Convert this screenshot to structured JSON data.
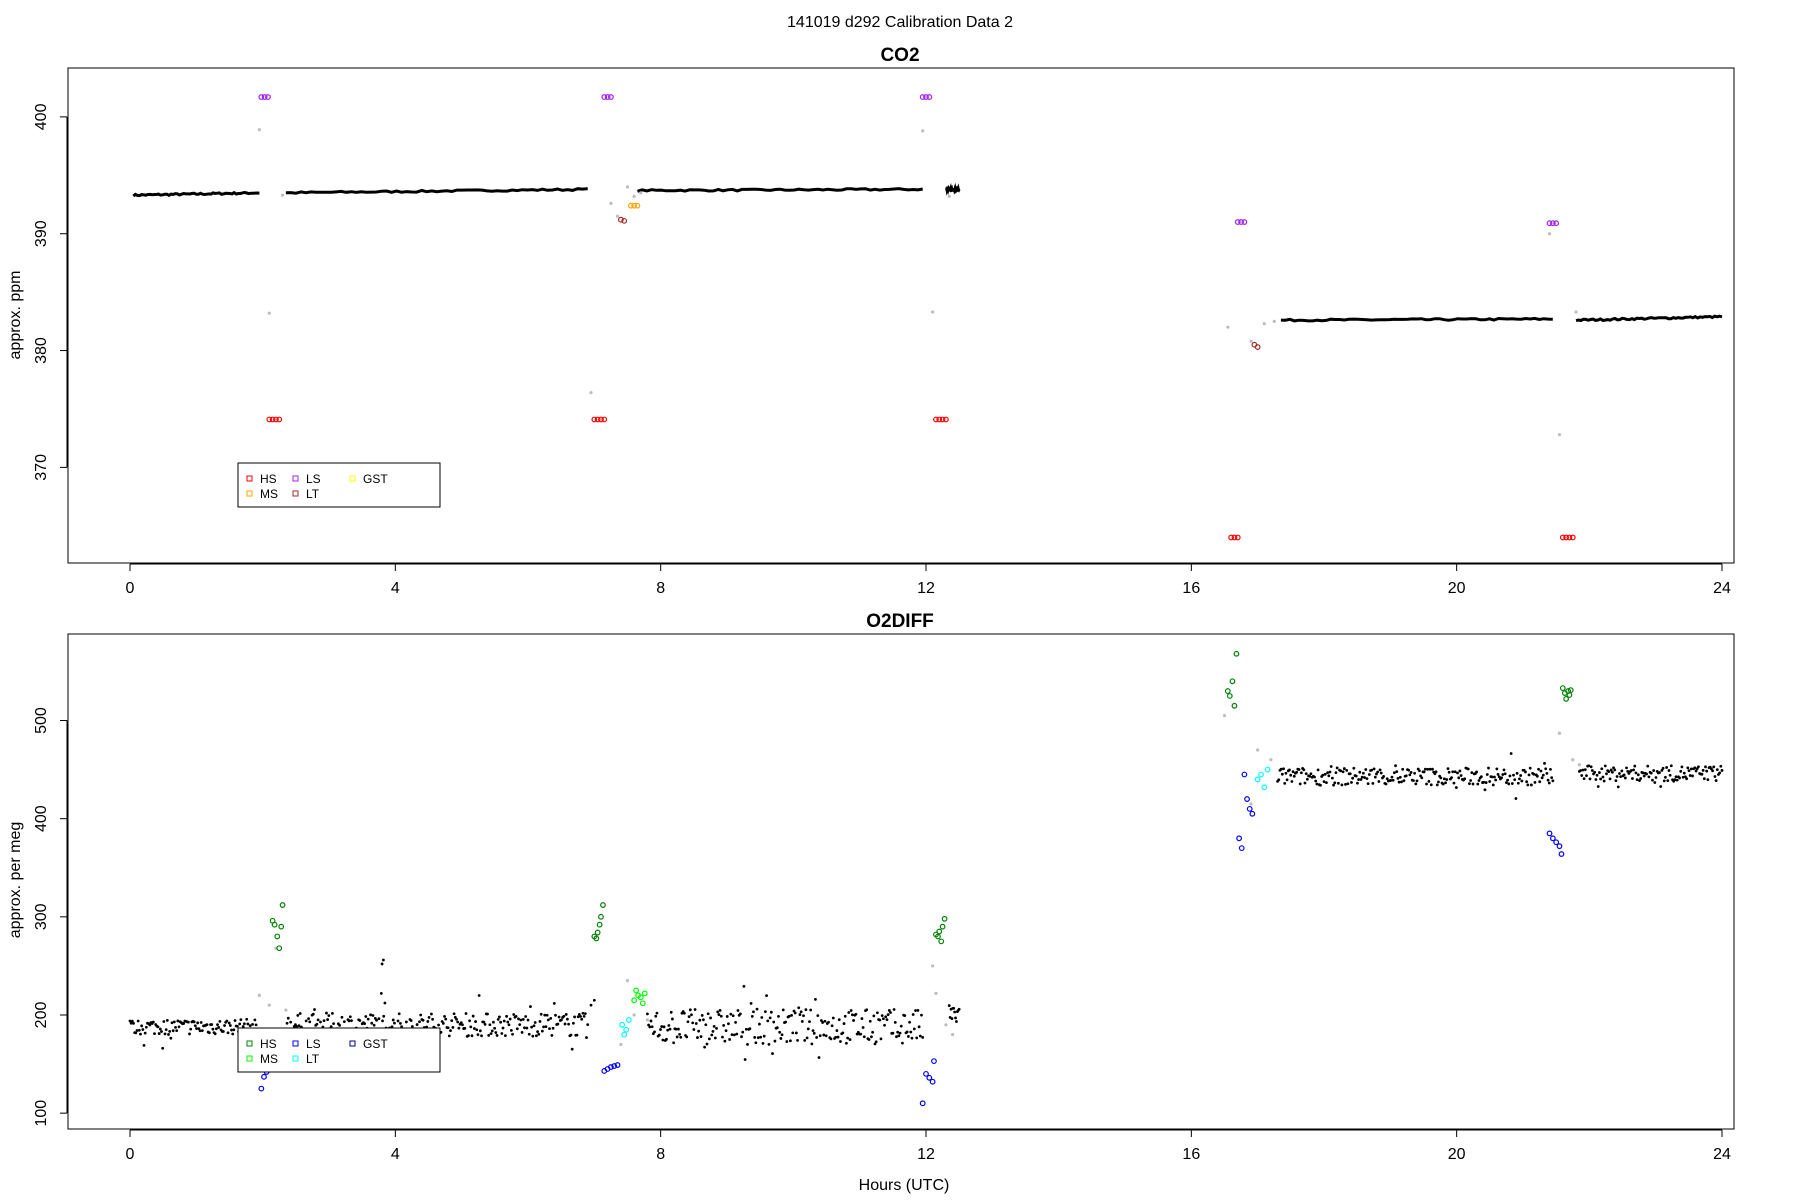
{
  "figure": {
    "title": "141019   d292   Calibration Data 2",
    "xlabel": "Hours (UTC)"
  },
  "chart_data": [
    {
      "type": "scatter",
      "title": "CO2",
      "xlabel": "",
      "ylabel": "approx. ppm",
      "xlim": [
        0,
        24
      ],
      "ylim": [
        362.5,
        403.5
      ],
      "xticks": [
        "0",
        "4",
        "8",
        "12",
        "16",
        "20",
        "24"
      ],
      "yticks": [
        "370",
        "380",
        "390",
        "400"
      ],
      "legend": {
        "position": "bottom-left",
        "entries": [
          {
            "label": "HS",
            "color": "#ff0000"
          },
          {
            "label": "LS",
            "color": "#a020f0"
          },
          {
            "label": "GST",
            "color": "#ffff00"
          },
          {
            "label": "MS",
            "color": "#ffa500"
          },
          {
            "label": "LT",
            "color": "#a52a2a"
          }
        ]
      },
      "grid": false,
      "ambient_segments": [
        {
          "x": [
            0.05,
            1.95
          ],
          "y": [
            393.3,
            393.5
          ]
        },
        {
          "x": [
            2.35,
            6.9
          ],
          "y": [
            393.5,
            393.8
          ]
        },
        {
          "x": [
            7.65,
            11.95
          ],
          "y": [
            393.7,
            393.8
          ]
        },
        {
          "x": [
            12.3,
            12.5
          ],
          "y": [
            393.8,
            393.8
          ]
        },
        {
          "x": [
            17.35,
            21.45
          ],
          "y": [
            382.6,
            382.7
          ]
        },
        {
          "x": [
            21.8,
            24.0
          ],
          "y": [
            382.6,
            382.9
          ]
        }
      ],
      "series": [
        {
          "name": "HS",
          "color": "#ff0000",
          "x": [
            2.1,
            2.15,
            2.2,
            2.25,
            7.0,
            7.05,
            7.1,
            7.15,
            12.15,
            12.2,
            12.25,
            12.3,
            16.6,
            16.65,
            16.7,
            21.6,
            21.65,
            21.7,
            21.75
          ],
          "y": [
            374.1,
            374.1,
            374.1,
            374.1,
            374.1,
            374.1,
            374.1,
            374.1,
            374.1,
            374.1,
            374.1,
            374.1,
            364.0,
            364.0,
            364.0,
            364.0,
            364.0,
            364.0,
            364.0
          ]
        },
        {
          "name": "LS",
          "color": "#a020f0",
          "x": [
            1.98,
            2.03,
            2.08,
            7.15,
            7.2,
            7.25,
            11.95,
            12.0,
            12.05,
            16.7,
            16.75,
            16.8,
            21.4,
            21.45,
            21.5
          ],
          "y": [
            401.7,
            401.7,
            401.7,
            401.7,
            401.7,
            401.7,
            401.7,
            401.7,
            401.7,
            391.0,
            391.0,
            391.0,
            390.9,
            390.9,
            390.9
          ]
        },
        {
          "name": "MS",
          "color": "#ffa500",
          "x": [
            7.55,
            7.6,
            7.65
          ],
          "y": [
            392.4,
            392.4,
            392.4
          ]
        },
        {
          "name": "LT",
          "color": "#a52a2a",
          "x": [
            7.4,
            7.45,
            16.95,
            17.0
          ],
          "y": [
            391.2,
            391.1,
            380.5,
            380.3
          ]
        },
        {
          "name": "GST",
          "color": "#ffff00",
          "x": [],
          "y": []
        }
      ],
      "transition_points": {
        "x": [
          1.95,
          2.1,
          2.3,
          6.95,
          7.25,
          7.35,
          7.5,
          7.6,
          7.7,
          11.95,
          12.1,
          12.35,
          16.55,
          16.9,
          17.1,
          17.25,
          21.4,
          21.55,
          21.8
        ],
        "y": [
          398.9,
          383.2,
          393.3,
          376.4,
          392.6,
          391.5,
          394.0,
          393.2,
          393.5,
          398.8,
          383.3,
          393.2,
          382.0,
          380.8,
          382.3,
          382.5,
          390.0,
          372.8,
          383.3
        ]
      }
    },
    {
      "type": "scatter",
      "title": "O2DIFF",
      "xlabel": "Hours (UTC)",
      "ylabel": "approx. per meg",
      "xlim": [
        0,
        24
      ],
      "ylim": [
        92,
        580
      ],
      "xticks": [
        "0",
        "4",
        "8",
        "12",
        "16",
        "20",
        "24"
      ],
      "yticks": [
        "100",
        "200",
        "300",
        "400",
        "500"
      ],
      "legend": {
        "position": "bottom-left",
        "entries": [
          {
            "label": "HS",
            "color": "#008000"
          },
          {
            "label": "LS",
            "color": "#0000ff"
          },
          {
            "label": "GST",
            "color": "#00008b"
          },
          {
            "label": "MS",
            "color": "#00ff00"
          },
          {
            "label": "LT",
            "color": "#00ffff"
          }
        ]
      },
      "grid": false,
      "ambient_segments": [
        {
          "x": [
            0.0,
            1.9
          ],
          "level": 188,
          "noise": 8
        },
        {
          "x": [
            2.35,
            6.9
          ],
          "level": 190,
          "noise": 12
        },
        {
          "x": [
            7.8,
            11.95
          ],
          "level": 188,
          "noise": 18
        },
        {
          "x": [
            12.35,
            12.5
          ],
          "level": 200,
          "noise": 10
        },
        {
          "x": [
            17.3,
            21.45
          ],
          "level": 443,
          "noise": 9
        },
        {
          "x": [
            21.85,
            24.0
          ],
          "level": 446,
          "noise": 8
        }
      ],
      "series": [
        {
          "name": "HS",
          "color": "#008000",
          "x": [
            2.15,
            2.18,
            2.22,
            2.25,
            2.28,
            2.3,
            7.0,
            7.03,
            7.05,
            7.08,
            7.1,
            7.13,
            12.15,
            12.18,
            12.2,
            12.23,
            12.25,
            12.28,
            16.55,
            16.58,
            16.62,
            16.65,
            16.68,
            21.6,
            21.63,
            21.65,
            21.68,
            21.7,
            21.72
          ],
          "y": [
            296,
            292,
            280,
            268,
            290,
            312,
            280,
            278,
            284,
            292,
            300,
            312,
            282,
            280,
            285,
            275,
            290,
            298,
            530,
            525,
            540,
            515,
            568,
            533,
            528,
            522,
            530,
            526,
            531
          ]
        },
        {
          "name": "LS",
          "color": "#0000ff",
          "x": [
            1.98,
            2.02,
            2.06,
            2.1,
            7.15,
            7.2,
            7.25,
            7.3,
            7.35,
            11.95,
            12.0,
            12.05,
            12.1,
            12.12,
            16.72,
            16.76,
            16.8,
            16.84,
            16.88,
            16.92,
            21.4,
            21.45,
            21.5,
            21.55,
            21.58
          ],
          "y": [
            125,
            137,
            142,
            148,
            143,
            145,
            147,
            148,
            149,
            110,
            140,
            136,
            132,
            153,
            380,
            370,
            445,
            420,
            410,
            405,
            385,
            380,
            376,
            372,
            364
          ]
        },
        {
          "name": "MS",
          "color": "#00ff00",
          "x": [
            7.6,
            7.63,
            7.66,
            7.7,
            7.73,
            7.76
          ],
          "y": [
            215,
            225,
            220,
            218,
            212,
            222
          ]
        },
        {
          "name": "LT",
          "color": "#00ffff",
          "x": [
            7.42,
            7.45,
            7.48,
            7.52,
            17.0,
            17.05,
            17.1,
            17.15
          ],
          "y": [
            190,
            180,
            185,
            195,
            440,
            445,
            432,
            450
          ]
        },
        {
          "name": "GST",
          "color": "#00008b",
          "x": [],
          "y": []
        }
      ],
      "outliers": {
        "x": [
          3.8,
          3.82,
          6.95,
          7.0
        ],
        "y": [
          252,
          256,
          210,
          215
        ]
      },
      "transition_points": {
        "x": [
          1.95,
          2.1,
          2.2,
          2.35,
          7.4,
          7.5,
          7.6,
          7.8,
          12.1,
          12.15,
          12.3,
          12.4,
          16.5,
          16.9,
          17.0,
          17.2,
          21.55,
          21.75,
          21.85
        ],
        "y": [
          220,
          210,
          268,
          205,
          170,
          235,
          200,
          195,
          250,
          222,
          190,
          180,
          505,
          415,
          470,
          460,
          487,
          460,
          455
        ]
      }
    }
  ]
}
